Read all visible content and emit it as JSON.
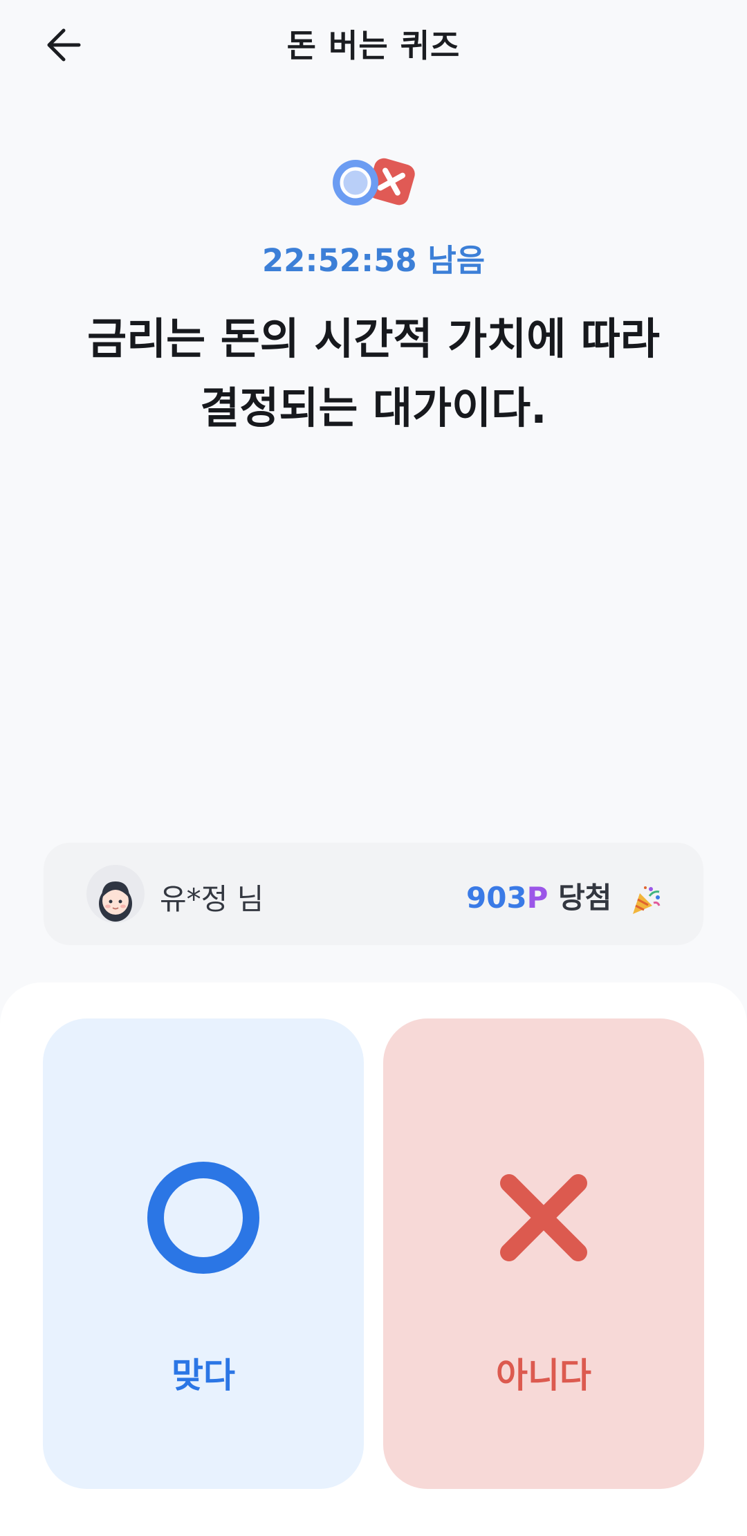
{
  "header": {
    "title": "돈 버는 퀴즈"
  },
  "icons": {
    "back": "arrow-left-icon",
    "logo": "ox-quiz-icon",
    "avatar": "girl-avatar",
    "party": "party-popper-icon",
    "yes": "circle-o-icon",
    "no": "x-icon"
  },
  "quiz": {
    "timer": "22:52:58 남음",
    "question_line1": "금리는 돈의 시간적 가치에 따라",
    "question_line2": "결정되는 대가이다."
  },
  "winner": {
    "name": "유*정 님",
    "points_number": "903",
    "points_unit": "P",
    "prize_label": "당첨"
  },
  "answers": {
    "yes_label": "맞다",
    "no_label": "아니다"
  },
  "colors": {
    "accent_blue": "#2b76e5",
    "accent_red": "#dc5a4f",
    "yes_bg": "#e8f2fe",
    "no_bg": "#f7d9d7",
    "timer": "#3c7fd7",
    "points_p": "#9b56e8"
  }
}
